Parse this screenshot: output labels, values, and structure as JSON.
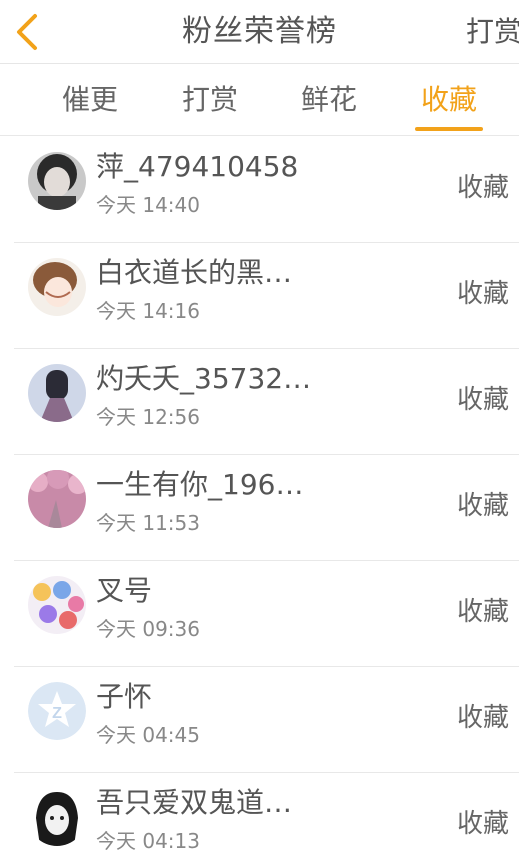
{
  "header": {
    "title": "粉丝荣誉榜",
    "right_label": "打赏"
  },
  "tabs": [
    {
      "label": "催更",
      "active": false
    },
    {
      "label": "打赏",
      "active": false
    },
    {
      "label": "鲜花",
      "active": false
    },
    {
      "label": "收藏",
      "active": true
    }
  ],
  "colors": {
    "accent": "#f2a21a",
    "text": "#555555",
    "muted": "#888888"
  },
  "fans": [
    {
      "name": "萍_479410458",
      "time": "今天 14:40",
      "action": "收藏",
      "avatar": "photo-portrait"
    },
    {
      "name": "白衣道长的黑…",
      "time": "今天 14:16",
      "action": "收藏",
      "avatar": "anime-girl"
    },
    {
      "name": "灼夭夭_35732…",
      "time": "今天 12:56",
      "action": "收藏",
      "avatar": "girl-skirt"
    },
    {
      "name": "一生有你_196…",
      "time": "今天 11:53",
      "action": "收藏",
      "avatar": "cherry-blossom"
    },
    {
      "name": "叉号",
      "time": "今天 09:36",
      "action": "收藏",
      "avatar": "cartoon-characters"
    },
    {
      "name": "子怀",
      "time": "今天 04:45",
      "action": "收藏",
      "avatar": "default-z-logo"
    },
    {
      "name": "吾只爱双鬼道…",
      "time": "今天 04:13",
      "action": "收藏",
      "avatar": "sketch-face"
    }
  ]
}
